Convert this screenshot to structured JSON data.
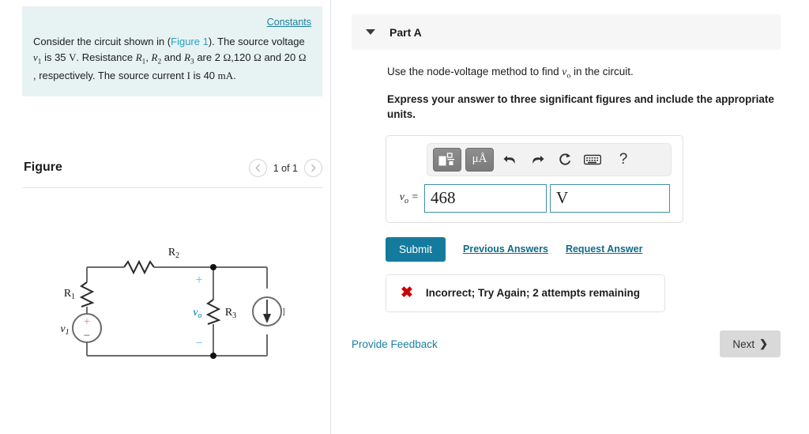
{
  "left": {
    "constants_label": "Constants",
    "problem": {
      "p1": "Consider the circuit shown in (",
      "figure_link": "Figure 1",
      "p2": "). The source voltage ",
      "v1": "v",
      "v1_sub": "1",
      "p3": " is 35 ",
      "unit_v": "V",
      "p4": ". Resistance ",
      "r1": "R",
      "r1_sub": "1",
      "p5": ", ",
      "r2": "R",
      "r2_sub": "2",
      "p6": " and ",
      "r3": "R",
      "r3_sub": "3",
      "p7": " are 2 ",
      "ohm1": "Ω",
      "p8": ",120 ",
      "ohm2": "Ω",
      "p9": " and 20 ",
      "ohm3": "Ω",
      "p10": " , respectively. The source current ",
      "cur": "I",
      "p11": " is 40 ",
      "unit_ma": "mA",
      "p12": "."
    },
    "figure": {
      "title": "Figure",
      "prev_icon": "chevron-left",
      "count": "1 of 1",
      "next_icon": "chevron-right"
    },
    "circuit": {
      "r1_label": "R",
      "r1_sub": "1",
      "r2_label": "R",
      "r2_sub": "2",
      "r3_label": "R",
      "r3_sub": "3",
      "v1_label": "v",
      "v1_sub": "1",
      "vo_label": "v",
      "vo_sub": "o",
      "plus": "+",
      "minus": "−",
      "src_plus": "+",
      "src_minus": "−",
      "current_label": "I"
    }
  },
  "right": {
    "part": {
      "caret_icon": "caret-down",
      "title": "Part A"
    },
    "question": {
      "p1": "Use the node-voltage method to find ",
      "vo": "v",
      "vo_sub": "o",
      "p2": " in the circuit."
    },
    "instruction": "Express your answer to three significant figures and include the appropriate units.",
    "toolbar": {
      "template_icon": "math-template-icon",
      "units_icon": "μÅ",
      "undo_icon": "↶",
      "redo_icon": "↷",
      "reset_icon": "↻",
      "keyboard_icon": "keyboard-icon",
      "help_icon": "?"
    },
    "answer": {
      "label_var": "v",
      "label_sub": "o",
      "label_eq": " =",
      "value": "468",
      "value_placeholder": "",
      "unit": "V",
      "unit_placeholder": ""
    },
    "actions": {
      "submit": "Submit",
      "previous_answers": "Previous Answers",
      "request_answer": "Request Answer"
    },
    "feedback": {
      "icon": "✖",
      "text": "Incorrect; Try Again; 2 attempts remaining"
    },
    "footer": {
      "provide_feedback": "Provide Feedback",
      "next": "Next",
      "next_chevron": "❯"
    }
  },
  "colors": {
    "accent_teal": "#137b9e",
    "link_blue": "#1b7f9e",
    "error_red": "#cc0000",
    "info_bg": "#e7f3f3",
    "circuit_label_blue": "#5bb8e8"
  }
}
